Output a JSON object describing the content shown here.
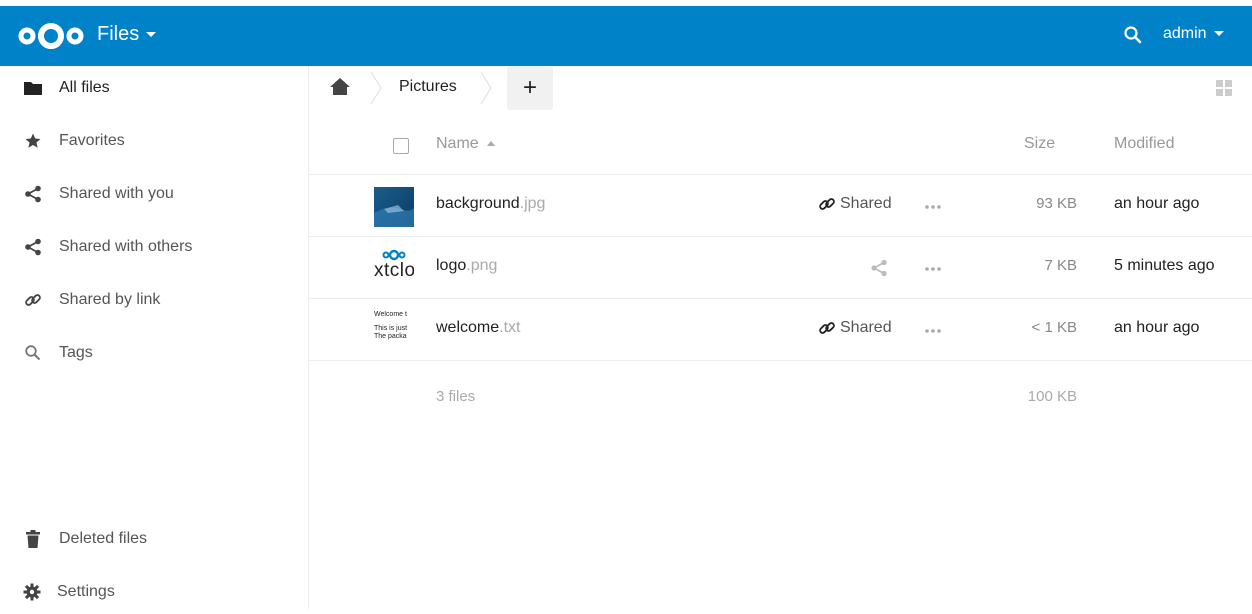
{
  "header": {
    "app_title": "Files",
    "user": "admin",
    "brand_color": "#0082c9",
    "icons": [
      "nextcloud-logo",
      "search-icon",
      "caret-down-icon"
    ]
  },
  "sidebar": {
    "items": [
      {
        "label": "All files",
        "icon": "folder-icon",
        "active": true
      },
      {
        "label": "Favorites",
        "icon": "star-icon"
      },
      {
        "label": "Shared with you",
        "icon": "share-icon"
      },
      {
        "label": "Shared with others",
        "icon": "share-icon"
      },
      {
        "label": "Shared by link",
        "icon": "link-icon"
      },
      {
        "label": "Tags",
        "icon": "search-icon"
      }
    ],
    "bottom": [
      {
        "label": "Deleted files",
        "icon": "trash-icon"
      },
      {
        "label": "Settings",
        "icon": "gear-icon"
      }
    ]
  },
  "breadcrumb": {
    "current": "Pictures",
    "add_label": "+"
  },
  "table": {
    "columns": {
      "name": "Name",
      "size": "Size",
      "modified": "Modified"
    },
    "rows": [
      {
        "base": "background",
        "ext": ".jpg",
        "share": "Shared",
        "size": "93 KB",
        "modified": "an hour ago"
      },
      {
        "base": "logo",
        "ext": ".png",
        "share": "",
        "size": "7 KB",
        "modified": "5 minutes ago"
      },
      {
        "base": "welcome",
        "ext": ".txt",
        "share": "Shared",
        "size": "< 1 KB",
        "modified": "an hour ago"
      }
    ],
    "thumbnails": {
      "logo_text": "xtclo",
      "welcome_lines": [
        "Welcome t",
        "This is just",
        "The packa"
      ]
    },
    "summary": {
      "files": "3 files",
      "size": "100 KB"
    }
  }
}
